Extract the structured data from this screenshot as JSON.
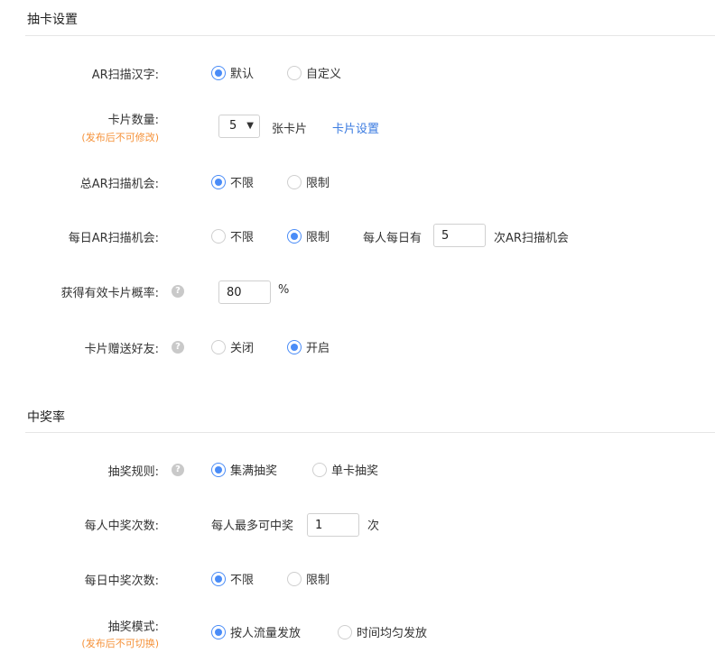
{
  "section1": {
    "title": "抽卡设置"
  },
  "section2": {
    "title": "中奖率"
  },
  "help_icon": "question-icon",
  "ar_scan_text": {
    "label": "AR扫描汉字:",
    "option1": "默认",
    "option2": "自定义"
  },
  "card_count": {
    "label": "卡片数量:",
    "note": "(发布后不可修改)",
    "value": "5",
    "unit": "张卡片",
    "link": "卡片设置"
  },
  "total_ar": {
    "label": "总AR扫描机会:",
    "option1": "不限",
    "option2": "限制"
  },
  "daily_ar": {
    "label": "每日AR扫描机会:",
    "option1": "不限",
    "option2": "限制",
    "prefix": "每人每日有",
    "value": "5",
    "suffix": "次AR扫描机会"
  },
  "probability": {
    "label": "获得有效卡片概率:",
    "value": "80",
    "unit": "%"
  },
  "gift": {
    "label": "卡片赠送好友:",
    "option1": "关闭",
    "option2": "开启"
  },
  "rule": {
    "label": "抽奖规则:",
    "option1": "集满抽奖",
    "option2": "单卡抽奖"
  },
  "win_times": {
    "label": "每人中奖次数:",
    "prefix": "每人最多可中奖",
    "value": "1",
    "suffix": "次"
  },
  "daily_win": {
    "label": "每日中奖次数:",
    "option1": "不限",
    "option2": "限制"
  },
  "mode": {
    "label": "抽奖模式:",
    "note": "(发布后不可切换)",
    "option1": "按人流量发放",
    "option2": "时间均匀发放"
  },
  "colors": {
    "accent": "#4a8cf7",
    "link": "#3b7be0",
    "note": "#f5923a"
  }
}
